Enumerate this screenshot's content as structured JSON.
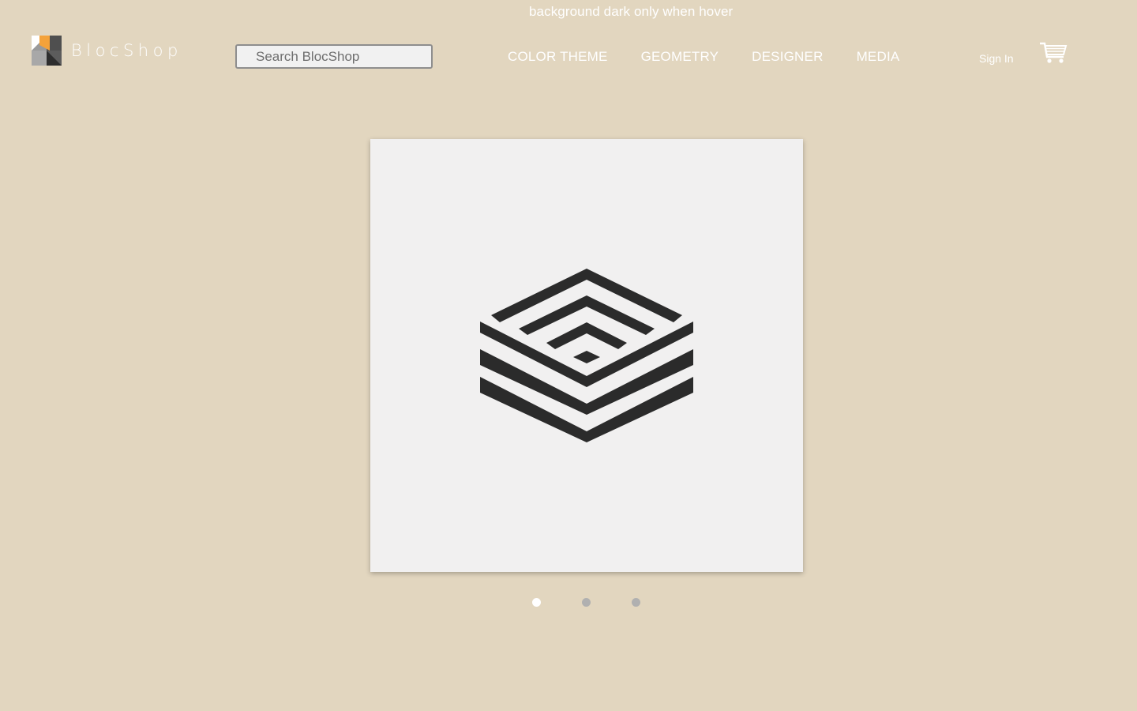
{
  "banner": {
    "hover_note": "background dark only when hover"
  },
  "header": {
    "brand": "BlocShop",
    "search_placeholder": "Search BlocShop",
    "nav": [
      {
        "label": "COLOR THEME"
      },
      {
        "label": "GEOMETRY"
      },
      {
        "label": "DESIGNER"
      },
      {
        "label": "MEDIA"
      }
    ],
    "sign_in": "Sign In",
    "cart_icon": "shopping-cart-icon"
  },
  "carousel": {
    "slide_icon": "isometric-layered-cube-logo",
    "active_index": 0,
    "total_slides": 3
  },
  "colors": {
    "page_background": "#e2d6bf",
    "text": "#ffffff",
    "slide_background": "#f1f0f0",
    "artwork": "#2b2b2b",
    "dot_active": "#ffffff",
    "dot_inactive": "#b0b0b0",
    "logo_orange": "#f4a23a"
  }
}
